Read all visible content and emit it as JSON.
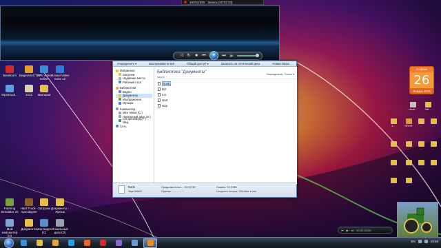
{
  "recorder": {
    "resolution": "1920x1080",
    "status": "Запись [00:02:33]"
  },
  "player": {
    "controls": [
      "shuffle",
      "repeat",
      "stop",
      "prev",
      "play",
      "next",
      "mute",
      "volume"
    ]
  },
  "desktop_icons": [
    {
      "label": "Bandicam",
      "color": "#d12b2b"
    },
    {
      "label": "ВидеоМАСТЕР",
      "color": "#e2a02a"
    },
    {
      "label": "AVS Video Editor",
      "color": "#3c8fd6"
    },
    {
      "label": "Movavi Video Suite 12",
      "color": "#2d7bd4"
    },
    {
      "label": "Mp33mp3...",
      "color": "#5aa0e0"
    },
    {
      "label": "2222",
      "color": "#d9d0b0"
    },
    {
      "label": "аватарки",
      "color": "#e3c04d"
    },
    {
      "label": "Farming Simulator 15",
      "color": "#7aa146"
    },
    {
      "label": "Hard Truck - Apocalypse",
      "color": "#8a5e2b"
    },
    {
      "label": "Загрузки",
      "color": "#e3c04d"
    },
    {
      "label": "Документы - Ярлык",
      "color": "#e3c04d"
    },
    {
      "label": "Мой компьютер (Н)",
      "color": "#7fa6d2"
    },
    {
      "label": "Документы",
      "color": "#e3c04d"
    },
    {
      "label": "Мои видео (С)",
      "color": "#5b8ec9"
    },
    {
      "label": "Локальный диск (D)",
      "color": "#9aa3ad"
    }
  ],
  "explorer": {
    "toolbar": [
      "Упорядочить ▾",
      "Воспроизвести всё",
      "Общий доступ ▾",
      "Записать на оптический диск",
      "Новая папка"
    ],
    "nav": {
      "favorites": "Избранное",
      "favorites_items": [
        "Загрузки",
        "Недавние места",
        "Рабочий стол"
      ],
      "libraries": "Библиотеки",
      "libraries_items": [
        "Видео",
        "Документы",
        "Изображения",
        "Музыка"
      ],
      "computer": "Компьютер",
      "computer_items": [
        "Mini ляпки (C:)",
        "Локальный диск (D:)",
        "CD-дисковод (F:) Мед"
      ],
      "network": "Сеть"
    },
    "library_title": "Библиотека \"Документы\"",
    "library_subtitle": "sound",
    "arrange_label": "Упорядочить:",
    "arrange_value": "Папка ▾",
    "files": [
      "honk",
      "bliz",
      "run",
      "start",
      "stop"
    ],
    "selected_file": "honk",
    "status": {
      "name": "honk",
      "type": "Звук WAVE",
      "duration_label": "Продолжительн...: 00:02:33",
      "rating_label": "Оценка:",
      "size_label": "Размер: 12,9 МБ",
      "bitrate_label": "Скорость потока: 705 кбит в сек"
    }
  },
  "calendar": {
    "weekday": "вторник",
    "day": "26",
    "month_year": "Январь 2016"
  },
  "right_icons": [
    {
      "label": "Hinal...",
      "color": "#c2c2c2"
    },
    {
      "label": "Hal...",
      "color": "#e3c04d"
    },
    {
      "label": "s...",
      "color": "#e3c04d"
    },
    {
      "label": "RRRR",
      "color": "#d9a03a"
    },
    {
      "label": "...",
      "color": "#e3c04d"
    },
    {
      "label": "...",
      "color": "#e3c04d"
    },
    {
      "label": "...",
      "color": "#e3c04d"
    },
    {
      "label": "...",
      "color": "#e3c04d"
    },
    {
      "label": "...",
      "color": "#e3c04d"
    },
    {
      "label": "...",
      "color": "#e3c04d"
    },
    {
      "label": "...",
      "color": "#e3c04d"
    },
    {
      "label": "...",
      "color": "#e3c04d"
    },
    {
      "label": "...",
      "color": "#e3c04d"
    },
    {
      "label": "...",
      "color": "#e3c04d"
    },
    {
      "label": "...",
      "color": "#e3c04d"
    },
    {
      "label": "...",
      "color": "#e3c04d"
    }
  ],
  "mini_player": {
    "time": "00:00 00:00"
  },
  "taskbar": {
    "buttons": [
      {
        "name": "taskbar-ie",
        "color": "#3c8fd6"
      },
      {
        "name": "taskbar-explorer",
        "color": "#e3c04d"
      },
      {
        "name": "taskbar-chrome",
        "color": "#d8a83a"
      },
      {
        "name": "taskbar-skype",
        "color": "#2aa0e8"
      },
      {
        "name": "taskbar-firefox",
        "color": "#e36a2a"
      },
      {
        "name": "taskbar-opera",
        "color": "#d12b2b"
      },
      {
        "name": "taskbar-wmp",
        "color": "#8a6ad0"
      },
      {
        "name": "taskbar-library",
        "color": "#6f9bd3"
      },
      {
        "name": "taskbar-player-active",
        "color": "#e88a2a"
      }
    ],
    "lang": "EN",
    "time": "23:46"
  }
}
